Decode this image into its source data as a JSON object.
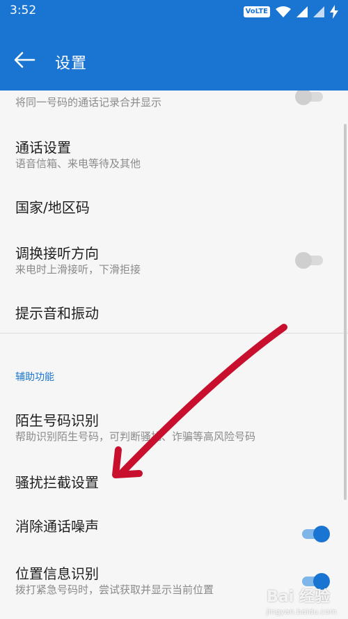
{
  "status_bar": {
    "time": "3:52",
    "volte": "VoLTE"
  },
  "app_bar": {
    "title": "设置"
  },
  "items": [
    {
      "title": "",
      "subtitle": "将同一号码的通话记录合并显示"
    },
    {
      "title": "通话设置",
      "subtitle": "语音信箱、来电等待及其他"
    },
    {
      "title": "国家/地区码",
      "subtitle": ""
    },
    {
      "title": "调换接听方向",
      "subtitle": "来电时上滑接听，下滑拒接"
    },
    {
      "title": "提示音和振动",
      "subtitle": ""
    },
    {
      "title": "陌生号码识别",
      "subtitle": "帮助识别陌生号码，可判断骚扰、诈骗等高风险号码"
    },
    {
      "title": "骚扰拦截设置",
      "subtitle": ""
    },
    {
      "title": "消除通话噪声",
      "subtitle": ""
    },
    {
      "title": "位置信息识别",
      "subtitle": "拨打紧急号码时，尝试获取并显示当前位置"
    }
  ],
  "section_header": "辅助功能",
  "toggles": {
    "merge_calls": false,
    "swap_answer": false,
    "noise_cancel": true,
    "location_id": true
  },
  "watermark": {
    "main": "Bai 经验",
    "sub": "jingyan.baidu.com"
  },
  "colors": {
    "primary": "#1a75d2",
    "annotation_arrow": "#c8102e"
  }
}
